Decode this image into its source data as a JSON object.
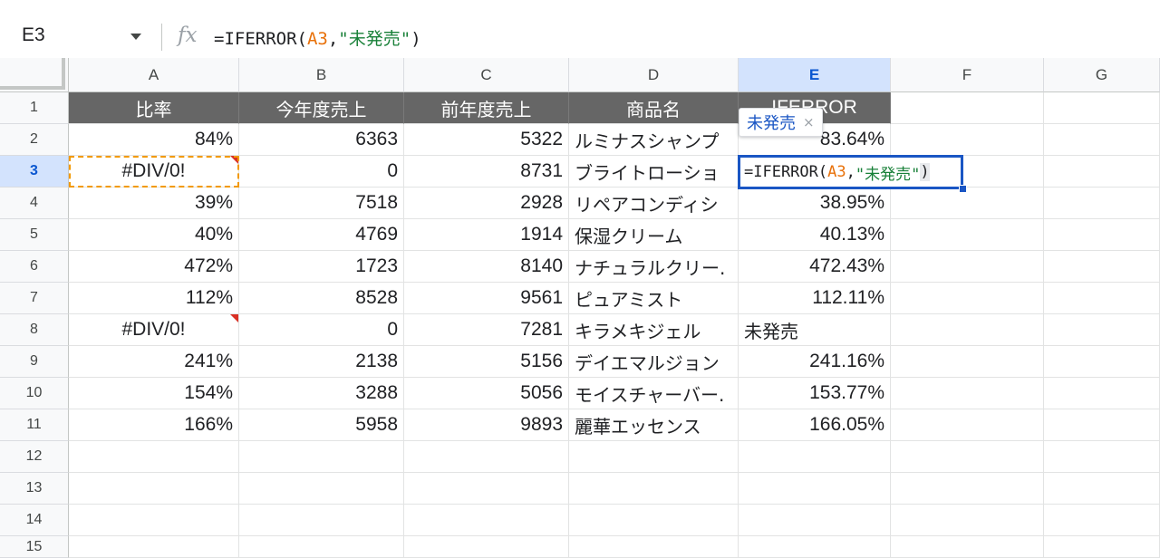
{
  "formula_bar": {
    "name_box": "E3",
    "fx_label": "fx",
    "formula_prefix": "=IFERROR(",
    "formula_ref": "A3",
    "formula_sep": ",",
    "formula_str": "\"未発売\"",
    "formula_suffix": ")"
  },
  "columns": [
    "A",
    "B",
    "C",
    "D",
    "E",
    "F",
    "G"
  ],
  "selected_column": "E",
  "rows": [
    "1",
    "2",
    "3",
    "4",
    "5",
    "6",
    "7",
    "8",
    "9",
    "10",
    "11",
    "12",
    "13",
    "14",
    "15"
  ],
  "selected_row": "3",
  "table": {
    "headers": [
      "比率",
      "今年度売上",
      "前年度売上",
      "商品名",
      "IFERROR"
    ],
    "data": [
      [
        "84%",
        "6363",
        "5322",
        "ルミナスシャンプ",
        "83.64%"
      ],
      [
        "#DIV/0!",
        "0",
        "8731",
        "ブライトローショ",
        ""
      ],
      [
        "39%",
        "7518",
        "2928",
        "リペアコンディシ",
        "38.95%"
      ],
      [
        "40%",
        "4769",
        "1914",
        "保湿クリーム",
        "40.13%"
      ],
      [
        "472%",
        "1723",
        "8140",
        "ナチュラルクリー.",
        "472.43%"
      ],
      [
        "112%",
        "8528",
        "9561",
        "ピュアミスト",
        "112.11%"
      ],
      [
        "#DIV/0!",
        "0",
        "7281",
        "キラメキジェル",
        "未発売"
      ],
      [
        "241%",
        "2138",
        "5156",
        "デイエマルジョン",
        "241.16%"
      ],
      [
        "154%",
        "3288",
        "5056",
        "モイスチャーバー.",
        "153.77%"
      ],
      [
        "166%",
        "5958",
        "9893",
        "麗華エッセンス",
        "166.05%"
      ]
    ]
  },
  "active_cell_editor": {
    "prefix": "=IFERROR(",
    "ref": "A3",
    "sep": ",",
    "str": "\"未発売\"",
    "suffix": ")"
  },
  "preview_tooltip": {
    "text": "未発売",
    "close": "×"
  },
  "colors": {
    "header_fill": "#666666",
    "selection_blue": "#1a56c4",
    "reference_orange": "#e8710a",
    "string_green": "#188038",
    "error_red": "#d93025"
  }
}
